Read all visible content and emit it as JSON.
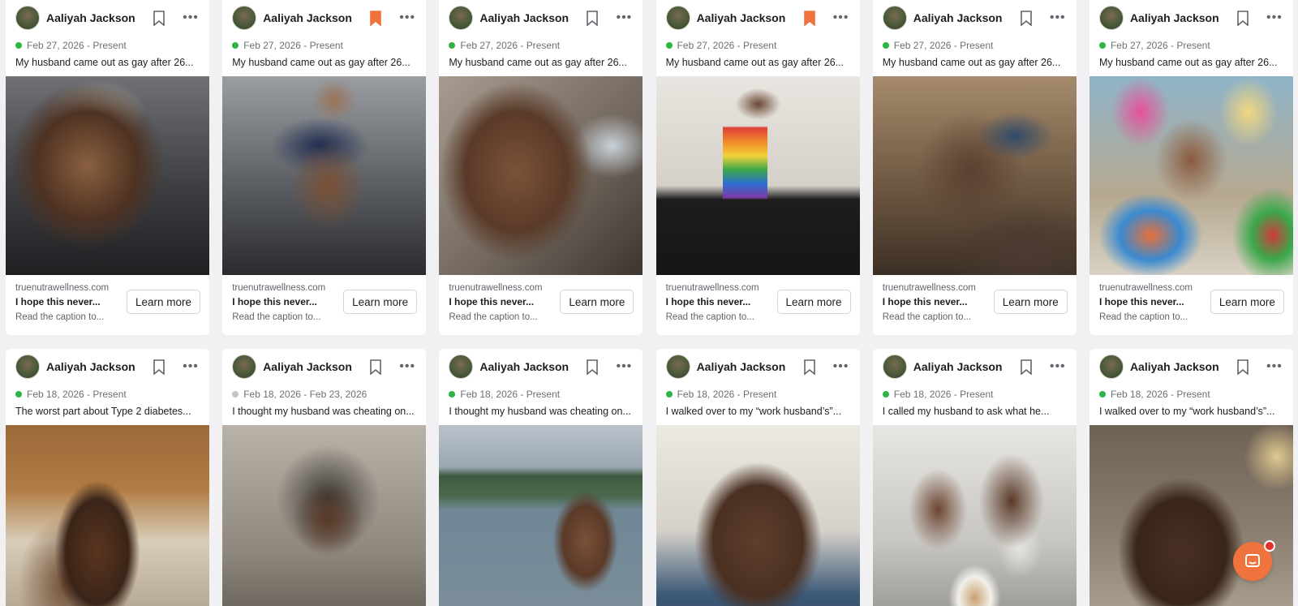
{
  "advertiser_name": "Aaliyah Jackson",
  "ad_domain": "truenutrawellness.com",
  "ad_headline": "I hope this never...",
  "ad_subtext": "Read the caption to...",
  "cta_label": "Learn more",
  "accent_color": "#f0733e",
  "active_color": "#2fb344",
  "row1": [
    {
      "date": "Feb 27, 2026 - Present",
      "active": true,
      "saved": false,
      "caption": "My husband came out as gay after 26...",
      "photo_desc": "Man with hair foil selfie in gym"
    },
    {
      "date": "Feb 27, 2026 - Present",
      "active": true,
      "saved": true,
      "caption": "My husband came out as gay after 26...",
      "photo_desc": "Man in crop top flexing in gym mirror"
    },
    {
      "date": "Feb 27, 2026 - Present",
      "active": true,
      "saved": false,
      "caption": "My husband came out as gay after 26...",
      "photo_desc": "Close-up selfie with makeup"
    },
    {
      "date": "Feb 27, 2026 - Present",
      "active": true,
      "saved": true,
      "caption": "My husband came out as gay after 26...",
      "photo_desc": "Man in rainbow mesh tank mirror selfie"
    },
    {
      "date": "Feb 27, 2026 - Present",
      "active": true,
      "saved": false,
      "caption": "My husband came out as gay after 26...",
      "photo_desc": "Man sitting on couch in living room"
    },
    {
      "date": "Feb 27, 2026 - Present",
      "active": true,
      "saved": false,
      "caption": "My husband came out as gay after 26...",
      "photo_desc": "Group selfie at brunch with drag queens"
    }
  ],
  "row2": [
    {
      "date": "Feb 18, 2026 - Present",
      "active": true,
      "saved": false,
      "caption": "The worst part about Type 2 diabetes...",
      "photo_desc": "Hand holding candy pack in kitchen"
    },
    {
      "date": "Feb 18, 2026 - Feb 23, 2026",
      "active": false,
      "saved": false,
      "caption": "I thought my husband was cheating on...",
      "photo_desc": "Woman mirror selfie"
    },
    {
      "date": "Feb 18, 2026 - Present",
      "active": true,
      "saved": false,
      "caption": "I thought my husband was cheating on...",
      "photo_desc": "Man selfie at lake"
    },
    {
      "date": "Feb 18, 2026 - Present",
      "active": true,
      "saved": false,
      "caption": "I walked over to my “work husband’s”...",
      "photo_desc": "Woman selfie in office"
    },
    {
      "date": "Feb 18, 2026 - Present",
      "active": true,
      "saved": false,
      "caption": "I called my husband to ask what he...",
      "photo_desc": "Couple with dog on couch"
    },
    {
      "date": "Feb 18, 2026 - Present",
      "active": true,
      "saved": false,
      "caption": "I walked over to my “work husband’s”...",
      "photo_desc": "Woman lying in bed"
    }
  ]
}
